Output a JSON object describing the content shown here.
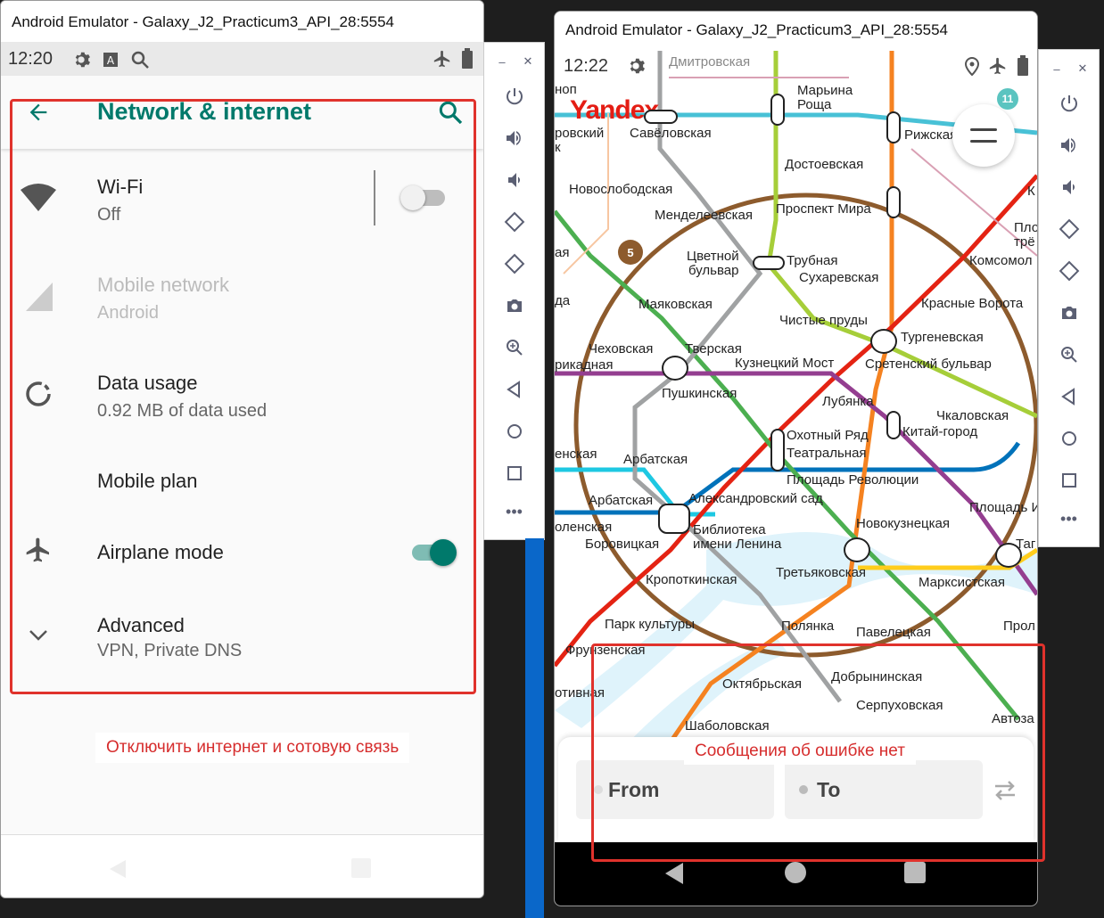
{
  "left_emulator": {
    "window_title": "Android Emulator - Galaxy_J2_Practicum3_API_28:5554",
    "status_time": "12:20",
    "appbar": {
      "title": "Network & internet"
    },
    "items": [
      {
        "title": "Wi-Fi",
        "subtitle": "Off",
        "toggle": "off",
        "enabled": true
      },
      {
        "title": "Mobile network",
        "subtitle": "Android",
        "enabled": false
      },
      {
        "title": "Data usage",
        "subtitle": "0.92 MB of data used",
        "enabled": true
      },
      {
        "title": "Mobile plan",
        "subtitle": "",
        "enabled": true
      },
      {
        "title": "Airplane mode",
        "subtitle": "",
        "toggle": "on",
        "enabled": true
      },
      {
        "title": "Advanced",
        "subtitle": "VPN, Private DNS",
        "enabled": true
      }
    ],
    "annotation": "Отключить интернет и сотовую связь"
  },
  "right_emulator": {
    "window_title": "Android Emulator - Galaxy_J2_Practicum3_API_28:5554",
    "status_time": "12:22",
    "map": {
      "logo": "Yandex",
      "badge_count": "11",
      "circle_label": "5",
      "stations": {
        "dmitrovskaya": "Дмитровская",
        "maryina_roshcha_1": "Марьина",
        "maryina_roshcha_2": "Роща",
        "savyolovskaya": "Савёловская",
        "rizhskaya": "Рижская",
        "dostoevskaya": "Достоевская",
        "novoslobodskaya": "Новослободская",
        "mendeleevskaya": "Менделеевская",
        "prospekt_mira": "Проспект Мира",
        "tsvetnoy_1": "Цветной",
        "tsvetnoy_2": "бульвар",
        "trubnaya": "Трубная",
        "sukharevskaya": "Сухаревская",
        "komsomolskaya": "Комсомол",
        "mayakovskaya": "Маяковская",
        "krasnye_vorota": "Красные Ворота",
        "chistye_prudy": "Чистые пруды",
        "turgenevskaya": "Тургеневская",
        "chekhovskaya": "Чеховская",
        "tverskaya": "Тверская",
        "kuznetsky_most": "Кузнецкий Мост",
        "sretensky": "Сретенский бульвар",
        "barrikadnaya": "рикадная",
        "pushkinskaya": "Пушкинская",
        "lubyanka": "Лубянка",
        "chkalovskaya": "Чкаловская",
        "okhotny_ryad": "Охотный Ряд",
        "kitay_gorod": "Китай-город",
        "teatralnaya": "Театральная",
        "smolenskaya": "енская",
        "arbatskaya_1": "Арбатская",
        "ploshchad_rev": "Площадь Революции",
        "arbatskaya_2": "Арбатская",
        "aleksandrovsky": "Александровский сад",
        "ploshchad_ilyicha": "Площадь И",
        "smolenskaya_2": "оленская",
        "biblioteka_1": "Библиотека",
        "biblioteka_2": "имени Ленина",
        "novokuznetskaya": "Новокузнецкая",
        "borovitskaya": "Боровицкая",
        "taganskaya": "Таг",
        "kropotkinskaya": "Кропоткинская",
        "tretyakovskaya": "Третьяковская",
        "marksistskaya": "Марксистская",
        "park_kultury": "Парк культуры",
        "polyanka": "Полянка",
        "paveletskaya": "Павелецкая",
        "proletarskaya": "Прол",
        "frunzenskaya": "Фрунзенская",
        "oktyabrskaya": "Октябрьская",
        "dobryninskaya": "Добрынинская",
        "serpukhovskaya": "Серпуховская",
        "sportivnaya": "отивная",
        "shabolovskaya": "Шаболовская",
        "avtozavodskaya": "Автоза",
        "edge_1": "ноп",
        "edge_2": "ровский",
        "edge_3": "к",
        "edge_4": "ая",
        "edge_5": "да",
        "edge_6": "К",
        "edge_7": "Пло",
        "edge_8": "трё"
      }
    },
    "route": {
      "from_placeholder": "From",
      "to_placeholder": "To"
    },
    "annotation": "Сообщения об ошибке нет"
  },
  "colors": {
    "accent_teal": "#00796b",
    "annotation_red": "#e0322c",
    "line_red": "#e42313",
    "line_green": "#4caf50",
    "line_blue": "#0072ba",
    "line_lightblue": "#1ec8e2",
    "line_brown": "#8d5b2d",
    "line_orange": "#f58220",
    "line_purple": "#943e90",
    "line_gray": "#a0a2a3",
    "line_lime": "#a6ce39",
    "line_yellow": "#ffcd1c"
  }
}
